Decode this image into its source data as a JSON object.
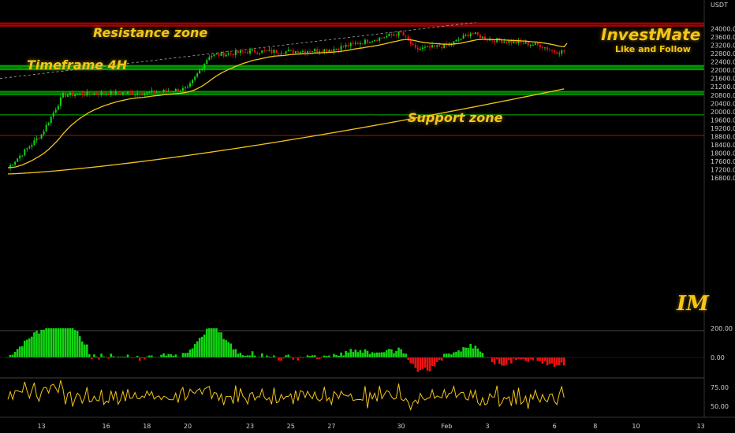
{
  "annotations": {
    "resistance": "Resistance zone",
    "timeframe": "Timeframe 4H",
    "support": "Support zone"
  },
  "brand": {
    "name": "InvestMate",
    "tagline": "Like and Follow",
    "logo": "IM"
  },
  "colors": {
    "accent": "#f5c518",
    "up": "#11d611",
    "down": "#ee1111",
    "resistance": "#c80000",
    "support": "#00b400"
  },
  "chart_data": [
    {
      "type": "candlestick",
      "title": "",
      "currency": "USDT",
      "timeframe": "4H",
      "ylim": [
        16700,
        24300
      ],
      "y_ticks": [
        24000,
        23600,
        23200,
        22800,
        22400,
        22000,
        21600,
        21200,
        20800,
        20400,
        20000,
        19600,
        19200,
        18800,
        18400,
        18000,
        17600,
        17200,
        16800
      ],
      "x_tick_labels": [
        "13",
        "16",
        "18",
        "20",
        "23",
        "25",
        "27",
        "30",
        "Feb",
        "3",
        "6",
        "8",
        "10",
        "13"
      ],
      "key_points": [
        {
          "x": "12",
          "close": 17300
        },
        {
          "x": "13",
          "close": 18900
        },
        {
          "x": "13",
          "close": 20800
        },
        {
          "x": "16",
          "close": 20900
        },
        {
          "x": "18",
          "close": 20900
        },
        {
          "x": "20",
          "close": 21100
        },
        {
          "x": "21",
          "close": 22700
        },
        {
          "x": "23",
          "close": 22900
        },
        {
          "x": "25",
          "close": 22900
        },
        {
          "x": "27",
          "close": 23000
        },
        {
          "x": "29",
          "close": 23800
        },
        {
          "x": "30",
          "close": 23000
        },
        {
          "x": "Feb",
          "close": 23200
        },
        {
          "x": "2",
          "close": 23800
        },
        {
          "x": "3",
          "close": 23500
        },
        {
          "x": "5",
          "close": 23200
        },
        {
          "x": "6",
          "close": 22900
        }
      ],
      "moving_average_fast_end": 23300,
      "moving_average_slow_end": 21100,
      "zones": [
        {
          "name": "resistance",
          "low": 24100,
          "high": 24300
        },
        {
          "name": "support",
          "low": 22000,
          "high": 22250
        },
        {
          "name": "support",
          "low": 20800,
          "high": 21000
        }
      ],
      "levels": [
        {
          "value": 19850,
          "color": "#00b400"
        },
        {
          "value": 18850,
          "color": "#c80000"
        }
      ],
      "trendline": {
        "from": 21600,
        "to": 24300,
        "style": "dashed"
      }
    },
    {
      "type": "histogram",
      "y_ticks": [
        200.0,
        0.0
      ],
      "tick_labels": [
        "200.00",
        "0.00"
      ]
    },
    {
      "type": "line",
      "y_ticks": [
        75.0,
        50.0
      ],
      "tick_labels": [
        "75.00",
        "50.00"
      ]
    }
  ]
}
